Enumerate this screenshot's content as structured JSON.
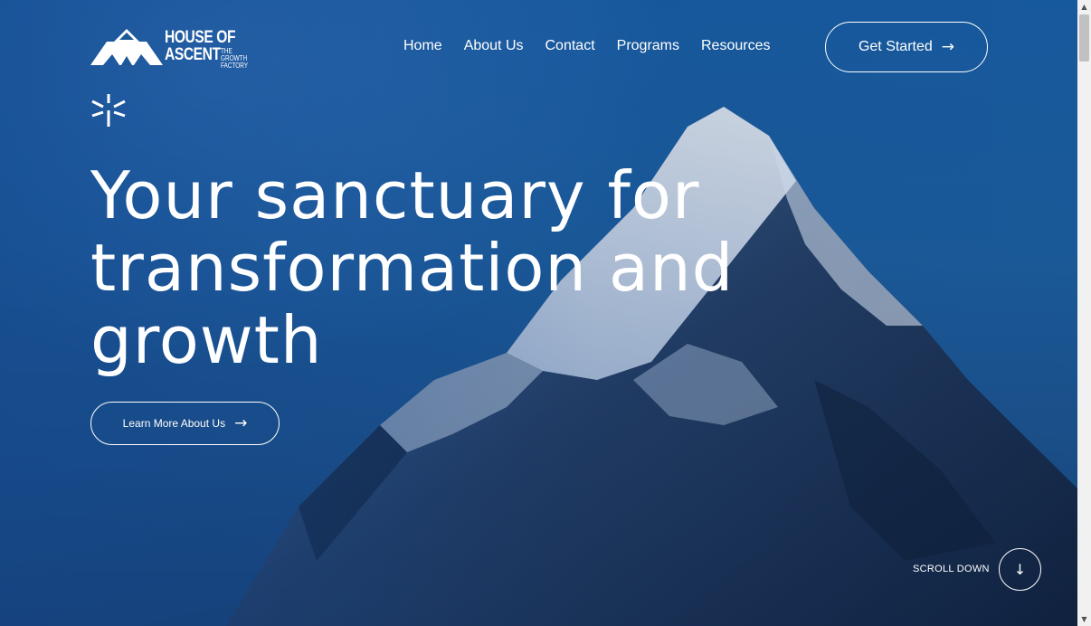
{
  "brand": {
    "line1": "HOUSE OF",
    "line2": "ASCENT",
    "tagline1": "THE GROWTH",
    "tagline2": "FACTORY"
  },
  "nav": {
    "items": [
      {
        "label": "Home"
      },
      {
        "label": "About Us"
      },
      {
        "label": "Contact"
      },
      {
        "label": "Programs"
      },
      {
        "label": "Resources"
      }
    ],
    "cta_label": "Get Started"
  },
  "hero": {
    "headline_line1": "Your sanctuary for",
    "headline_line2": "transformation and",
    "headline_line3": "growth",
    "learn_more_label": "Learn More About Us",
    "scroll_label": "SCROLL DOWN"
  },
  "icons": {
    "arrow_right": "→",
    "arrow_down": "↓"
  },
  "colors": {
    "primary_blue": "#1a5a98",
    "text": "#ffffff"
  }
}
